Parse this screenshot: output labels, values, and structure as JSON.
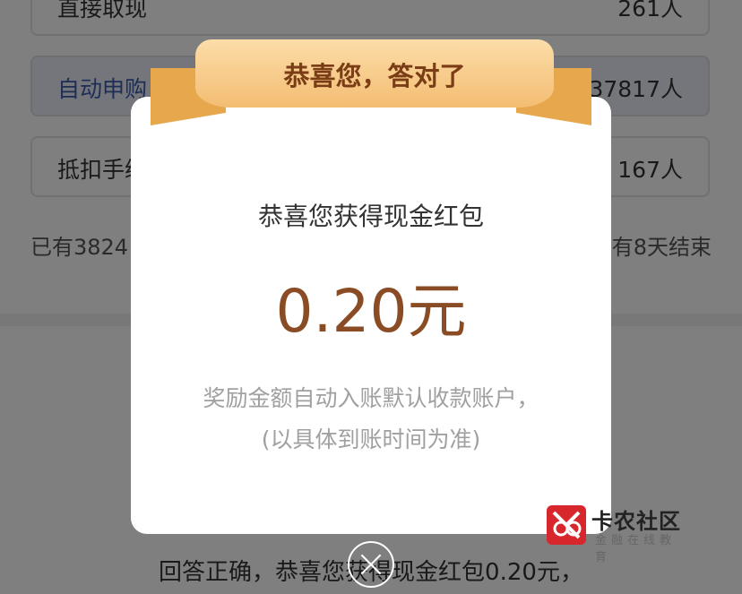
{
  "options": [
    {
      "label": "直接取现",
      "count": "261人",
      "selected": false
    },
    {
      "label": "自动申购",
      "count": "37817人",
      "selected": true
    },
    {
      "label": "抵扣手续",
      "count": "167人",
      "selected": false
    }
  ],
  "stats": {
    "left": "已有3824",
    "right": "有8天结束"
  },
  "answer_text": "回答正确，恭喜您获得现金红包0.20元，",
  "modal": {
    "ribbon_text": "恭喜您，答对了",
    "title": "恭喜您获得现金红包",
    "amount": "0.20元",
    "note_line1": "奖励金额自动入账默认收款账户，",
    "note_line2": "(以具体到账时间为准)"
  },
  "watermark": {
    "name": "卡农社区",
    "sub": "金融在线教育"
  },
  "colors": {
    "amount": "#8a4c24",
    "ribbon": "#f3bd72",
    "selected_label": "#3a5aa8"
  },
  "icons": {
    "close": "close-icon",
    "logo": "kanong-logo"
  }
}
